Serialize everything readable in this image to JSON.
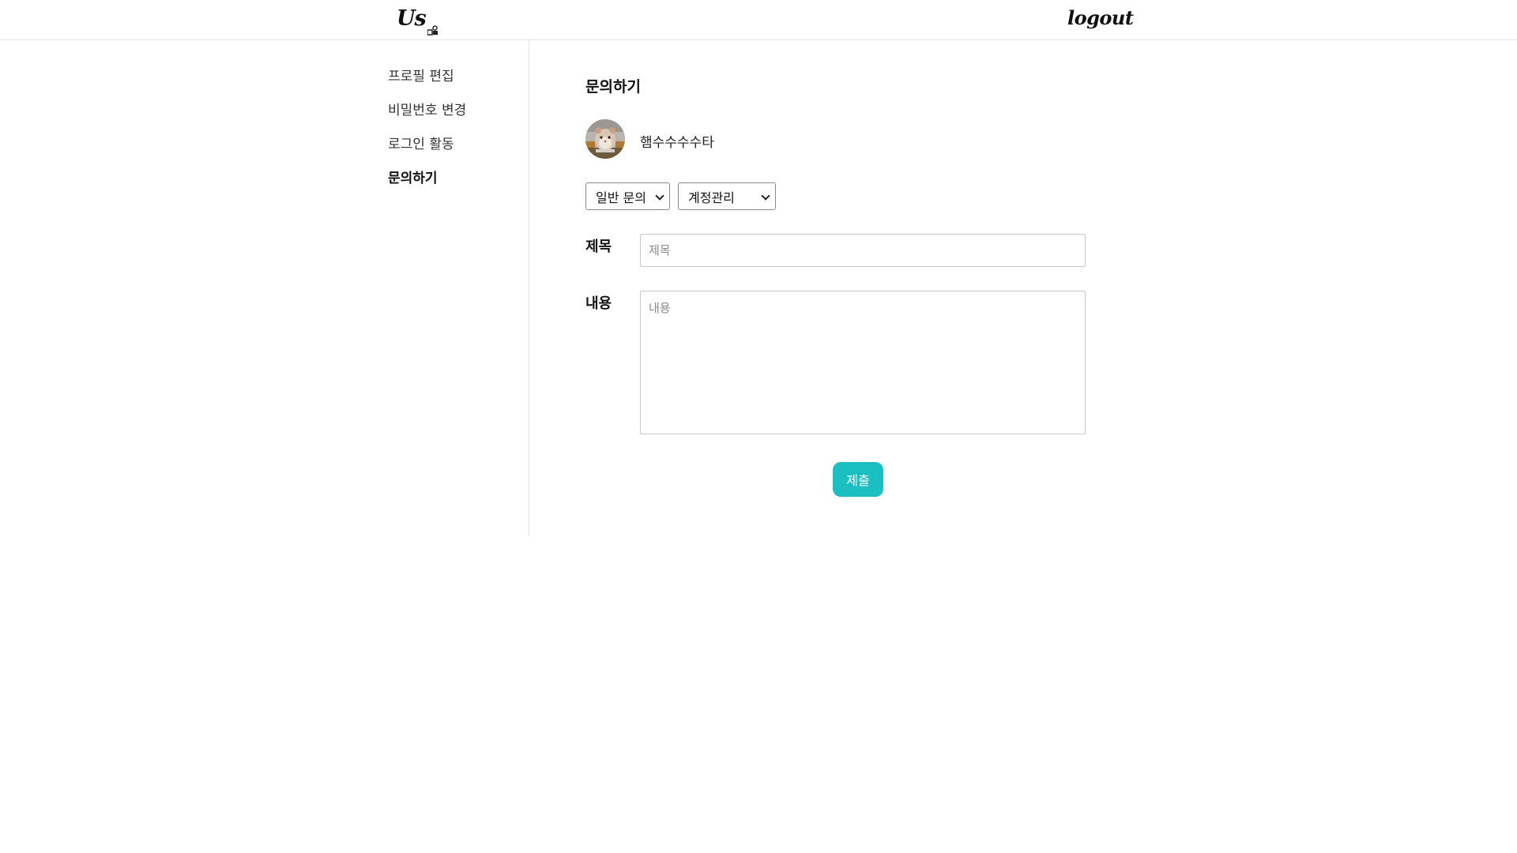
{
  "header": {
    "logo_text": "Us",
    "logout_label": "logout"
  },
  "sidebar": {
    "items": [
      {
        "label": "프로필 편집"
      },
      {
        "label": "비밀번호 변경"
      },
      {
        "label": "로그인 활동"
      },
      {
        "label": "문의하기"
      }
    ],
    "active_index": 3
  },
  "main": {
    "title": "문의하기",
    "user": {
      "name": "햄수수수수타",
      "avatar_icon": "hamster-avatar"
    },
    "category_select": {
      "value": "일반 문의"
    },
    "subcategory_select": {
      "value": "계정관리"
    },
    "title_field": {
      "label": "제목",
      "placeholder": "제목",
      "value": ""
    },
    "content_field": {
      "label": "내용",
      "placeholder": "내용",
      "value": ""
    },
    "submit_label": "제출"
  },
  "colors": {
    "accent": "#1bbfc1",
    "border": "#e2e2e2"
  }
}
